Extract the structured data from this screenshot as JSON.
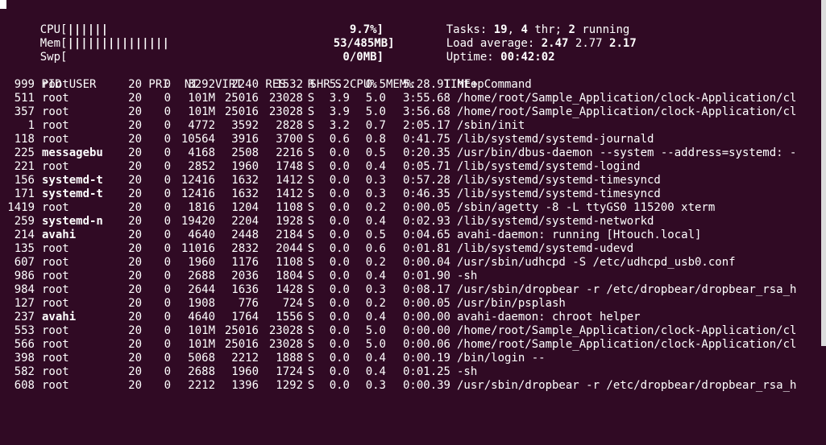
{
  "meters": {
    "cpu": {
      "label": "CPU[",
      "bar": "||||||",
      "value": "9.7%]"
    },
    "mem": {
      "label": "Mem[",
      "bar": "|||||||||||||||",
      "value": "53/485MB]"
    },
    "swp": {
      "label": "Swp[",
      "bar": "",
      "value": "0/0MB]"
    }
  },
  "summary": {
    "tasks_label": "Tasks: ",
    "tasks": "19",
    "tasks_sep": ", ",
    "threads": "4",
    "threads_label": " thr; ",
    "running": "2",
    "running_label": " running",
    "load_label": "Load average: ",
    "load1": "2.47",
    "load5": "2.77",
    "load15": "2.17",
    "uptime_label": "Uptime: ",
    "uptime": "00:42:02"
  },
  "table": {
    "headers": {
      "pid": "PID",
      "user": "USER",
      "pri": "PRI",
      "ni": "NI",
      "virt": "VIRT",
      "res": "RES",
      "shr": "SHR",
      "s": "S",
      "cpu": "CPU%",
      "mem": "MEM%",
      "time": "TIME+",
      "command": "Command"
    },
    "rows": [
      {
        "pid": "999",
        "user": "root",
        "pri": "20",
        "ni": "0",
        "virt": "3292",
        "res": "2240",
        "shr": "1532",
        "s": "R",
        "cpu": "5.2",
        "mem": "0.5",
        "time": "5:28.91",
        "command": "htop"
      },
      {
        "pid": "511",
        "user": "root",
        "pri": "20",
        "ni": "0",
        "virt": "101M",
        "res": "25016",
        "shr": "23028",
        "s": "S",
        "cpu": "3.9",
        "mem": "5.0",
        "time": "3:55.68",
        "command": "/home/root/Sample_Application/clock-Application/cl"
      },
      {
        "pid": "357",
        "user": "root",
        "pri": "20",
        "ni": "0",
        "virt": "101M",
        "res": "25016",
        "shr": "23028",
        "s": "S",
        "cpu": "3.9",
        "mem": "5.0",
        "time": "3:56.68",
        "command": "/home/root/Sample_Application/clock-Application/cl"
      },
      {
        "pid": "1",
        "user": "root",
        "pri": "20",
        "ni": "0",
        "virt": "4772",
        "res": "3592",
        "shr": "2828",
        "s": "S",
        "cpu": "3.2",
        "mem": "0.7",
        "time": "2:05.17",
        "command": "/sbin/init"
      },
      {
        "pid": "118",
        "user": "root",
        "pri": "20",
        "ni": "0",
        "virt": "10564",
        "res": "3916",
        "shr": "3700",
        "s": "S",
        "cpu": "0.6",
        "mem": "0.8",
        "time": "0:41.75",
        "command": "/lib/systemd/systemd-journald"
      },
      {
        "pid": "225",
        "user": "messagebu",
        "pri": "20",
        "ni": "0",
        "virt": "4168",
        "res": "2508",
        "shr": "2216",
        "s": "S",
        "cpu": "0.0",
        "mem": "0.5",
        "time": "0:20.35",
        "command": "/usr/bin/dbus-daemon --system --address=systemd: -"
      },
      {
        "pid": "221",
        "user": "root",
        "pri": "20",
        "ni": "0",
        "virt": "2852",
        "res": "1960",
        "shr": "1748",
        "s": "S",
        "cpu": "0.0",
        "mem": "0.4",
        "time": "0:05.71",
        "command": "/lib/systemd/systemd-logind"
      },
      {
        "pid": "156",
        "user": "systemd-t",
        "pri": "20",
        "ni": "0",
        "virt": "12416",
        "res": "1632",
        "shr": "1412",
        "s": "S",
        "cpu": "0.0",
        "mem": "0.3",
        "time": "0:57.28",
        "command": "/lib/systemd/systemd-timesyncd"
      },
      {
        "pid": "171",
        "user": "systemd-t",
        "pri": "20",
        "ni": "0",
        "virt": "12416",
        "res": "1632",
        "shr": "1412",
        "s": "S",
        "cpu": "0.0",
        "mem": "0.3",
        "time": "0:46.35",
        "command": "/lib/systemd/systemd-timesyncd"
      },
      {
        "pid": "1419",
        "user": "root",
        "pri": "20",
        "ni": "0",
        "virt": "1816",
        "res": "1204",
        "shr": "1108",
        "s": "S",
        "cpu": "0.0",
        "mem": "0.2",
        "time": "0:00.05",
        "command": "/sbin/agetty -8 -L ttyGS0 115200 xterm"
      },
      {
        "pid": "259",
        "user": "systemd-n",
        "pri": "20",
        "ni": "0",
        "virt": "19420",
        "res": "2204",
        "shr": "1928",
        "s": "S",
        "cpu": "0.0",
        "mem": "0.4",
        "time": "0:02.93",
        "command": "/lib/systemd/systemd-networkd"
      },
      {
        "pid": "214",
        "user": "avahi",
        "pri": "20",
        "ni": "0",
        "virt": "4640",
        "res": "2448",
        "shr": "2184",
        "s": "S",
        "cpu": "0.0",
        "mem": "0.5",
        "time": "0:04.65",
        "command": "avahi-daemon: running [Htouch.local]"
      },
      {
        "pid": "135",
        "user": "root",
        "pri": "20",
        "ni": "0",
        "virt": "11016",
        "res": "2832",
        "shr": "2044",
        "s": "S",
        "cpu": "0.0",
        "mem": "0.6",
        "time": "0:01.81",
        "command": "/lib/systemd/systemd-udevd"
      },
      {
        "pid": "607",
        "user": "root",
        "pri": "20",
        "ni": "0",
        "virt": "1960",
        "res": "1176",
        "shr": "1108",
        "s": "S",
        "cpu": "0.0",
        "mem": "0.2",
        "time": "0:00.04",
        "command": "/usr/sbin/udhcpd -S /etc/udhcpd_usb0.conf"
      },
      {
        "pid": "986",
        "user": "root",
        "pri": "20",
        "ni": "0",
        "virt": "2688",
        "res": "2036",
        "shr": "1804",
        "s": "S",
        "cpu": "0.0",
        "mem": "0.4",
        "time": "0:01.90",
        "command": "-sh"
      },
      {
        "pid": "984",
        "user": "root",
        "pri": "20",
        "ni": "0",
        "virt": "2644",
        "res": "1636",
        "shr": "1428",
        "s": "S",
        "cpu": "0.0",
        "mem": "0.3",
        "time": "0:08.17",
        "command": "/usr/sbin/dropbear -r /etc/dropbear/dropbear_rsa_h"
      },
      {
        "pid": "127",
        "user": "root",
        "pri": "20",
        "ni": "0",
        "virt": "1908",
        "res": "776",
        "shr": "724",
        "s": "S",
        "cpu": "0.0",
        "mem": "0.2",
        "time": "0:00.05",
        "command": "/usr/bin/psplash"
      },
      {
        "pid": "237",
        "user": "avahi",
        "pri": "20",
        "ni": "0",
        "virt": "4640",
        "res": "1764",
        "shr": "1556",
        "s": "S",
        "cpu": "0.0",
        "mem": "0.4",
        "time": "0:00.00",
        "command": "avahi-daemon: chroot helper"
      },
      {
        "pid": "553",
        "user": "root",
        "pri": "20",
        "ni": "0",
        "virt": "101M",
        "res": "25016",
        "shr": "23028",
        "s": "S",
        "cpu": "0.0",
        "mem": "5.0",
        "time": "0:00.00",
        "command": "/home/root/Sample_Application/clock-Application/cl"
      },
      {
        "pid": "566",
        "user": "root",
        "pri": "20",
        "ni": "0",
        "virt": "101M",
        "res": "25016",
        "shr": "23028",
        "s": "S",
        "cpu": "0.0",
        "mem": "5.0",
        "time": "0:00.06",
        "command": "/home/root/Sample_Application/clock-Application/cl"
      },
      {
        "pid": "398",
        "user": "root",
        "pri": "20",
        "ni": "0",
        "virt": "5068",
        "res": "2212",
        "shr": "1888",
        "s": "S",
        "cpu": "0.0",
        "mem": "0.4",
        "time": "0:00.19",
        "command": "/bin/login --"
      },
      {
        "pid": "582",
        "user": "root",
        "pri": "20",
        "ni": "0",
        "virt": "2688",
        "res": "1960",
        "shr": "1724",
        "s": "S",
        "cpu": "0.0",
        "mem": "0.4",
        "time": "0:01.25",
        "command": "-sh"
      },
      {
        "pid": "608",
        "user": "root",
        "pri": "20",
        "ni": "0",
        "virt": "2212",
        "res": "1396",
        "shr": "1292",
        "s": "S",
        "cpu": "0.0",
        "mem": "0.3",
        "time": "0:00.39",
        "command": "/usr/sbin/dropbear -r /etc/dropbear/dropbear_rsa_h"
      }
    ]
  },
  "colors": {
    "background": "#300a24",
    "foreground": "#ffffff"
  }
}
